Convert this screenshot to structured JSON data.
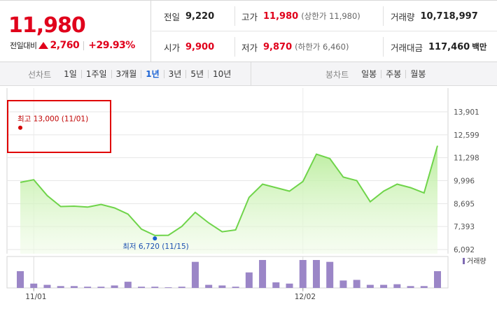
{
  "summary": {
    "price": "11,980",
    "change_label": "전일대비",
    "change_amount": "2,760",
    "change_rate": "+29.93%",
    "stats": [
      {
        "key": "전일",
        "value": "9,220"
      },
      {
        "key": "고가",
        "value": "11,980",
        "sub": "(상한가 11,980)"
      },
      {
        "key": "거래량",
        "value": "10,718,997"
      },
      {
        "key": "시가",
        "value": "9,900"
      },
      {
        "key": "저가",
        "value": "9,870",
        "sub": "(하한가 6,460)"
      },
      {
        "key": "거래대금",
        "value": "117,460",
        "unit": "백만"
      }
    ]
  },
  "toolbar": {
    "line_label": "선차트",
    "line_options": [
      "1일",
      "1주일",
      "3개월",
      "1년",
      "3년",
      "5년",
      "10년"
    ],
    "line_selected": "1년",
    "candle_label": "봉차트",
    "candle_options": [
      "일봉",
      "주봉",
      "월봉"
    ]
  },
  "colors": {
    "up": "#e0001b",
    "selected": "#1a62d4",
    "line": "#6fd44a",
    "volume": "#9b86c7"
  },
  "chart_data": {
    "type": "area",
    "y_ticks": [
      "13,901",
      "12,599",
      "11,298",
      "9,996",
      "8,695",
      "7,393",
      "6,092"
    ],
    "ylim": [
      6092,
      13901
    ],
    "x_labels": [
      {
        "index": 1,
        "label": "11/01"
      },
      {
        "index": 21,
        "label": "12/02"
      }
    ],
    "series": [
      {
        "values": [
          9900,
          10050,
          9150,
          8530,
          8550,
          8500,
          8650,
          8450,
          8100,
          7250,
          6890,
          6900,
          7400,
          8200,
          7600,
          7100,
          7200,
          9050,
          9800,
          9600,
          9400,
          9950,
          11500,
          11250,
          10200,
          10000,
          8800,
          9400,
          9800,
          9600,
          9300,
          11980
        ]
      }
    ],
    "volume_label": "거래량",
    "volume": [
      27,
      7,
      5,
      3,
      3,
      2,
      2,
      4,
      10,
      2,
      2,
      1,
      2,
      42,
      5,
      4,
      2,
      25,
      45,
      9,
      7,
      45,
      45,
      42,
      12,
      13,
      5,
      5,
      6,
      3,
      3,
      27
    ],
    "annotations": {
      "high": {
        "index": 0,
        "value": 13000,
        "label": "최고 13,000 (11/01)"
      },
      "low": {
        "index": 10,
        "value": 6720,
        "label": "최저 6,720 (11/15)"
      }
    }
  }
}
